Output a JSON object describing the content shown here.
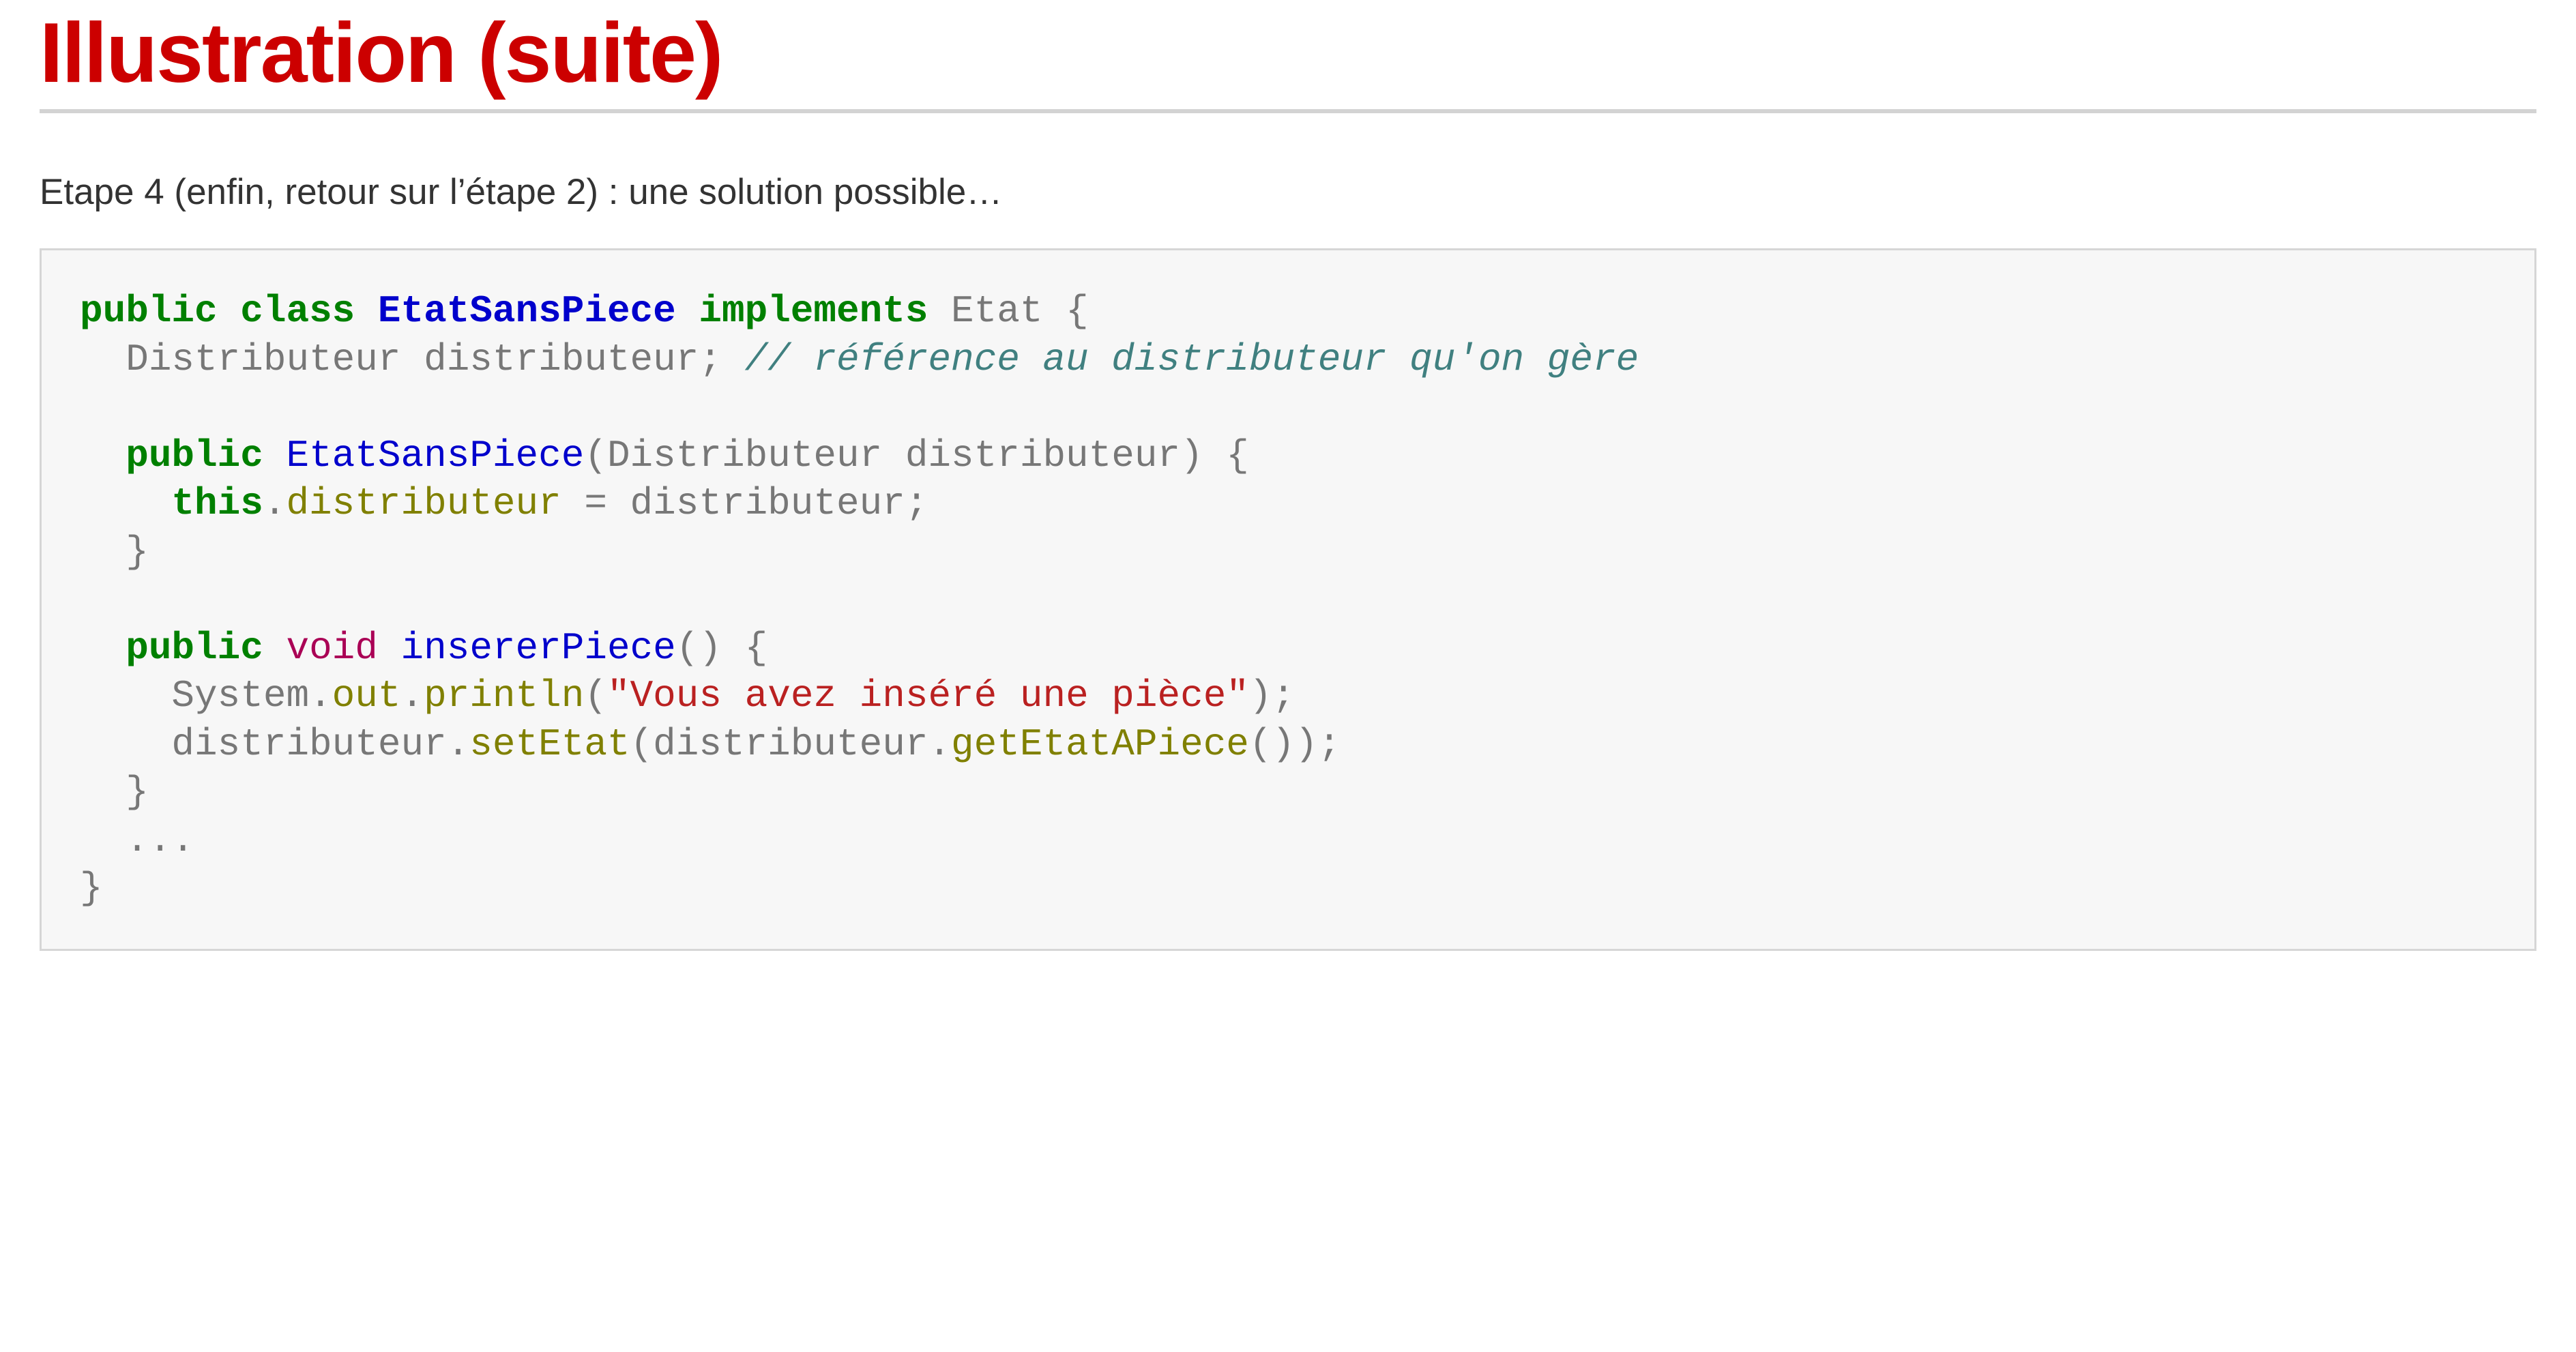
{
  "slide": {
    "title": "Illustration (suite)",
    "intro": "Etape 4 (enfin, retour sur l’étape 2) : une solution possible…"
  },
  "code": {
    "language": "java",
    "lines": [
      [
        {
          "t": "public",
          "c": "kw"
        },
        {
          "t": " "
        },
        {
          "t": "class",
          "c": "kw"
        },
        {
          "t": " "
        },
        {
          "t": "EtatSansPiece",
          "c": "cls"
        },
        {
          "t": " "
        },
        {
          "t": "implements",
          "c": "kw"
        },
        {
          "t": " Etat {"
        }
      ],
      [
        {
          "t": "  Distributeur distributeur; "
        },
        {
          "t": "// référence au distributeur qu'on gère",
          "c": "com"
        }
      ],
      [],
      [
        {
          "t": "  "
        },
        {
          "t": "public",
          "c": "kw"
        },
        {
          "t": " "
        },
        {
          "t": "EtatSansPiece",
          "c": "fn"
        },
        {
          "t": "(Distributeur distributeur) {"
        }
      ],
      [
        {
          "t": "    "
        },
        {
          "t": "this",
          "c": "kw"
        },
        {
          "t": "."
        },
        {
          "t": "distributeur",
          "c": "mem"
        },
        {
          "t": " = distributeur;"
        }
      ],
      [
        {
          "t": "  }"
        }
      ],
      [],
      [
        {
          "t": "  "
        },
        {
          "t": "public",
          "c": "kw"
        },
        {
          "t": " "
        },
        {
          "t": "void",
          "c": "typ"
        },
        {
          "t": " "
        },
        {
          "t": "insererPiece",
          "c": "fn"
        },
        {
          "t": "() {"
        }
      ],
      [
        {
          "t": "    System."
        },
        {
          "t": "out",
          "c": "mem"
        },
        {
          "t": "."
        },
        {
          "t": "println",
          "c": "mem"
        },
        {
          "t": "("
        },
        {
          "t": "\"Vous avez inséré une pièce\"",
          "c": "str"
        },
        {
          "t": ");"
        }
      ],
      [
        {
          "t": "    distributeur."
        },
        {
          "t": "setEtat",
          "c": "mem"
        },
        {
          "t": "(distributeur."
        },
        {
          "t": "getEtatAPiece",
          "c": "mem"
        },
        {
          "t": "());"
        }
      ],
      [
        {
          "t": "  }"
        }
      ],
      [
        {
          "t": "  ..."
        }
      ],
      [
        {
          "t": "}"
        }
      ]
    ]
  }
}
